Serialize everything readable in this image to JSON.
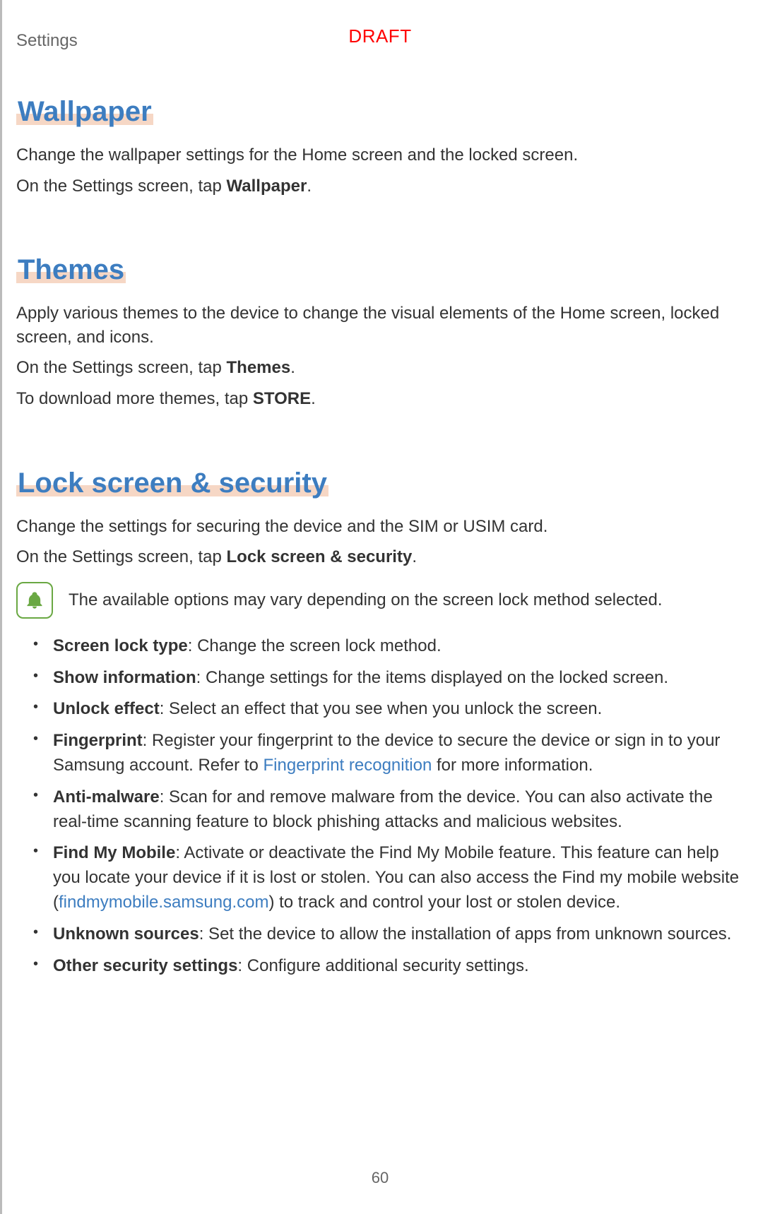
{
  "header": {
    "section": "Settings",
    "draft": "DRAFT"
  },
  "wallpaper": {
    "heading": "Wallpaper",
    "p1": "Change the wallpaper settings for the Home screen and the locked screen.",
    "p2_pre": "On the Settings screen, tap ",
    "p2_bold": "Wallpaper",
    "p2_post": "."
  },
  "themes": {
    "heading": "Themes",
    "p1": "Apply various themes to the device to change the visual elements of the Home screen, locked screen, and icons.",
    "p2_pre": "On the Settings screen, tap ",
    "p2_bold": "Themes",
    "p2_post": ".",
    "p3_pre": "To download more themes, tap ",
    "p3_bold": "STORE",
    "p3_post": "."
  },
  "lock": {
    "heading": "Lock screen & security",
    "p1": "Change the settings for securing the device and the SIM or USIM card.",
    "p2_pre": "On the Settings screen, tap ",
    "p2_bold": "Lock screen & security",
    "p2_post": ".",
    "note": "The available options may vary depending on the screen lock method selected.",
    "items": [
      {
        "bold": "Screen lock type",
        "text": ": Change the screen lock method."
      },
      {
        "bold": "Show information",
        "text": ": Change settings for the items displayed on the locked screen."
      },
      {
        "bold": "Unlock effect",
        "text": ": Select an effect that you see when you unlock the screen."
      },
      {
        "bold": "Fingerprint",
        "text_pre": ": Register your fingerprint to the device to secure the device or sign in to your Samsung account. Refer to ",
        "link": "Fingerprint recognition",
        "text_post": " for more information."
      },
      {
        "bold": "Anti-malware",
        "text": ": Scan for and remove malware from the device. You can also activate the real-time scanning feature to block phishing attacks and malicious websites."
      },
      {
        "bold": "Find My Mobile",
        "text_pre": ": Activate or deactivate the Find My Mobile feature. This feature can help you locate your device if it is lost or stolen. You can also access the Find my mobile website (",
        "link": "findmymobile.samsung.com",
        "text_post": ") to track and control your lost or stolen device."
      },
      {
        "bold": "Unknown sources",
        "text": ": Set the device to allow the installation of apps from unknown sources."
      },
      {
        "bold": "Other security settings",
        "text": ": Configure additional security settings."
      }
    ]
  },
  "page_number": "60"
}
